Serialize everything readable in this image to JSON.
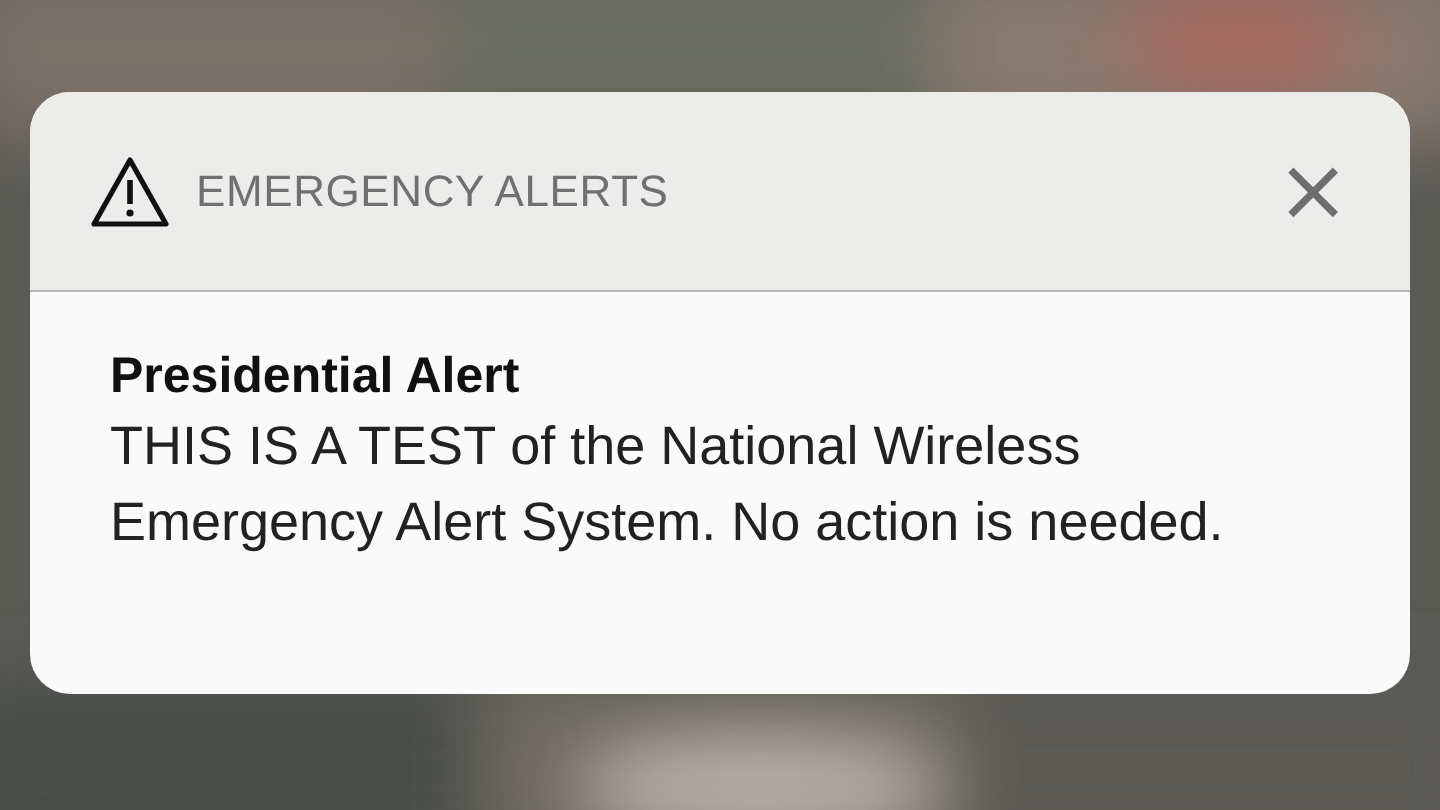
{
  "notification": {
    "app": "EMERGENCY ALERTS",
    "close": "×",
    "title": "Presidential Alert",
    "body": "THIS IS A TEST of the National Wireless Emergency Alert System. No action is needed."
  }
}
